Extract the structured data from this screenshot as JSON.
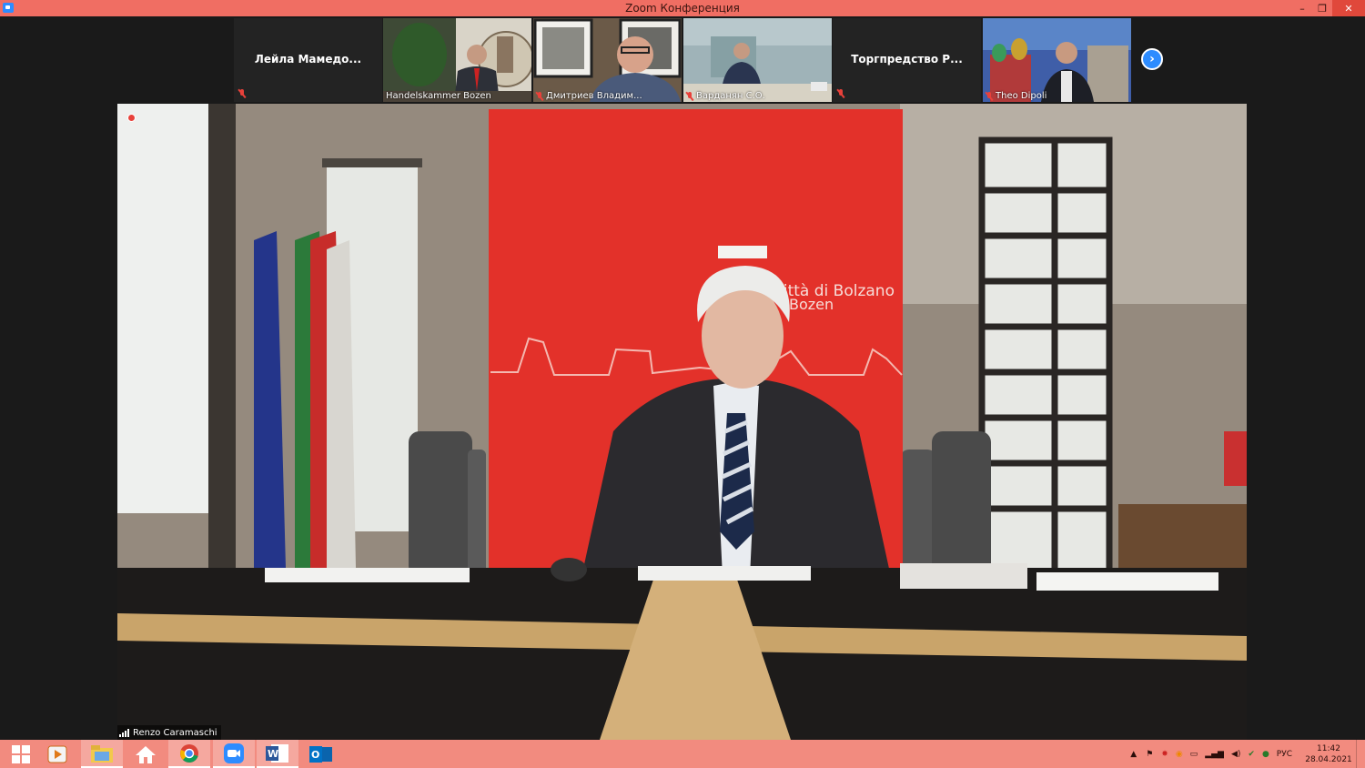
{
  "window": {
    "title": "Zoom Конференция",
    "controls": {
      "minimize": "–",
      "restore": "❐",
      "close": "✕"
    }
  },
  "participants": [
    {
      "name": "Лейла  Мамедо...",
      "video": false,
      "muted": true
    },
    {
      "name": "Handelskammer Bozen",
      "video": true,
      "muted": false
    },
    {
      "name": "Дмитриев Владим...",
      "video": true,
      "muted": true
    },
    {
      "name": "Варданян С.О.",
      "video": true,
      "muted": true
    },
    {
      "name": "Торгпредство  Р...",
      "video": false,
      "muted": true
    },
    {
      "name": "Theo Dipoli",
      "video": true,
      "muted": true
    }
  ],
  "strip_next_icon": "chevron-right-icon",
  "active_speaker": {
    "name": "Renzo Caramaschi",
    "backdrop_text_line1": "Città di Bolzano",
    "backdrop_text_line2": "Bozen"
  },
  "taskbar": {
    "apps": [
      "windows-start-icon",
      "media-player-icon",
      "file-explorer-icon",
      "home-icon",
      "chrome-icon",
      "zoom-icon",
      "word-icon",
      "outlook-icon"
    ],
    "language": "РУС",
    "time": "11:42",
    "date": "28.04.2021"
  },
  "colors": {
    "titlebar": "#f06e63",
    "taskbar": "#f28b7f",
    "zoom_blue": "#2d8cff",
    "muted_red": "#e8413a",
    "backdrop_red": "#e3312a"
  }
}
